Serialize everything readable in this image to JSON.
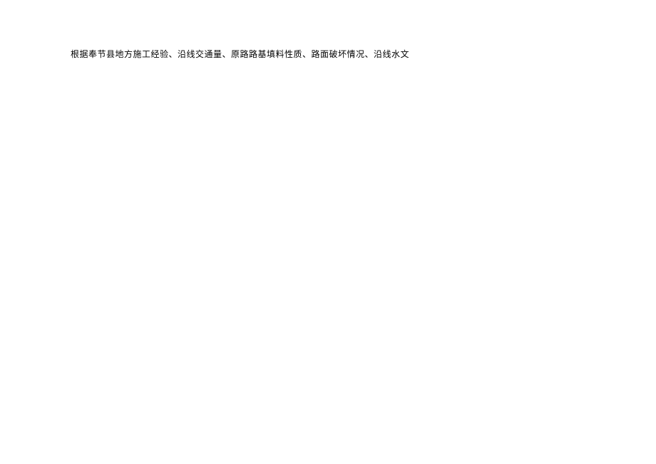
{
  "document": {
    "body_text": "根据奉节县地方施工经验、沿线交通量、原路路基填料性质、路面破坏情况、沿线水文"
  }
}
